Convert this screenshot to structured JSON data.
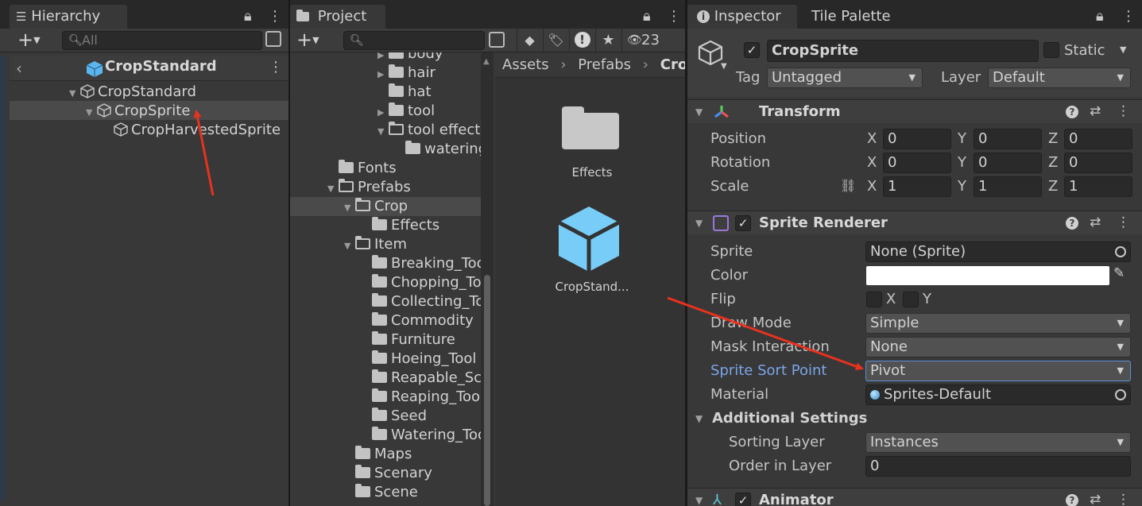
{
  "hierarchy": {
    "tab_label": "Hierarchy",
    "search_placeholder": "All",
    "scene_title": "CropStandard",
    "tree": [
      {
        "label": "CropStandard",
        "depth": 0,
        "expanded": true
      },
      {
        "label": "CropSprite",
        "depth": 1,
        "expanded": true,
        "selected": true
      },
      {
        "label": "CropHarvestedSprite",
        "depth": 2
      }
    ]
  },
  "project": {
    "tab_label": "Project",
    "search_value": "",
    "hidden_count": "23",
    "breadcrumb": [
      "Assets",
      "Prefabs",
      "Crop"
    ],
    "tree": [
      {
        "label": "body",
        "depth": 4,
        "arrow": "right"
      },
      {
        "label": "hair",
        "depth": 4,
        "arrow": "right"
      },
      {
        "label": "hat",
        "depth": 4
      },
      {
        "label": "tool",
        "depth": 4,
        "arrow": "right"
      },
      {
        "label": "tool effect",
        "depth": 4,
        "arrow": "down",
        "open": true
      },
      {
        "label": "watering",
        "depth": 5
      },
      {
        "label": "Fonts",
        "depth": 1
      },
      {
        "label": "Prefabs",
        "depth": 1,
        "arrow": "down",
        "open": true
      },
      {
        "label": "Crop",
        "depth": 2,
        "arrow": "down",
        "open": true,
        "selected": true
      },
      {
        "label": "Effects",
        "depth": 3
      },
      {
        "label": "Item",
        "depth": 2,
        "arrow": "down",
        "open": true
      },
      {
        "label": "Breaking_Tool",
        "depth": 3
      },
      {
        "label": "Chopping_Tool",
        "depth": 3
      },
      {
        "label": "Collecting_Tool",
        "depth": 3
      },
      {
        "label": "Commodity",
        "depth": 3
      },
      {
        "label": "Furniture",
        "depth": 3
      },
      {
        "label": "Hoeing_Tool",
        "depth": 3
      },
      {
        "label": "Reapable_Scenery",
        "depth": 3
      },
      {
        "label": "Reaping_Tool",
        "depth": 3
      },
      {
        "label": "Seed",
        "depth": 3
      },
      {
        "label": "Watering_Tool",
        "depth": 3
      },
      {
        "label": "Maps",
        "depth": 2
      },
      {
        "label": "Scenary",
        "depth": 2
      },
      {
        "label": "Scene",
        "depth": 2
      }
    ],
    "assets": [
      {
        "label": "Effects",
        "icon": "folder-icon"
      },
      {
        "label": "CropStand...",
        "icon": "prefab-cube-icon"
      }
    ]
  },
  "inspector": {
    "tab_label": "Inspector",
    "tab2_label": "Tile Palette",
    "object_name": "CropSprite",
    "static_label": "Static",
    "tag_label": "Tag",
    "tag_value": "Untagged",
    "layer_label": "Layer",
    "layer_value": "Default",
    "transform": {
      "title": "Transform",
      "rows": [
        {
          "label": "Position",
          "x": "0",
          "y": "0",
          "z": "0"
        },
        {
          "label": "Rotation",
          "x": "0",
          "y": "0",
          "z": "0"
        },
        {
          "label": "Scale",
          "x": "1",
          "y": "1",
          "z": "1"
        }
      ]
    },
    "sprite_renderer": {
      "title": "Sprite Renderer",
      "sprite_label": "Sprite",
      "sprite_value": "None (Sprite)",
      "color_label": "Color",
      "color_value": "#ffffff",
      "flip_label": "Flip",
      "flip_x": "X",
      "flip_y": "Y",
      "draw_mode_label": "Draw Mode",
      "draw_mode_value": "Simple",
      "mask_label": "Mask Interaction",
      "mask_value": "None",
      "sort_point_label": "Sprite Sort Point",
      "sort_point_value": "Pivot",
      "material_label": "Material",
      "material_value": "Sprites-Default",
      "additional_title": "Additional Settings",
      "sorting_layer_label": "Sorting Layer",
      "sorting_layer_value": "Instances",
      "order_label": "Order in Layer",
      "order_value": "0"
    },
    "animator": {
      "title": "Animator"
    }
  },
  "colors": {
    "accent_blue": "#7cc6ff",
    "highlight_label": "#7ba5e8",
    "annotation_red": "#e8321e"
  }
}
